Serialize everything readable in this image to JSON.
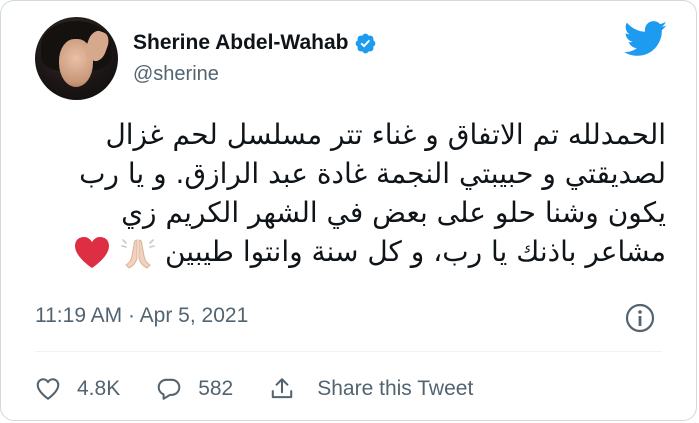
{
  "author": {
    "display_name": "Sherine Abdel-Wahab",
    "handle": "@sherine",
    "verified": true
  },
  "tweet": {
    "text_lines": [
      "الحمدلله تم الاتفاق و غناء تتر مسلسل لحم غزال",
      "لصديقتي و حبيبتي النجمة غادة عبد الرازق. و يا رب",
      "يكون وشنا حلو على بعض في الشهر الكريم زي",
      "مشاعر باذنك يا رب، و كل سنة وانتوا طيبين"
    ],
    "emojis": [
      "folded-hands-emoji",
      "red-heart-emoji"
    ],
    "timestamp": "11:19 AM · Apr 5, 2021"
  },
  "actions": {
    "like_count": "4.8K",
    "reply_count": "582",
    "share_label": "Share this Tweet"
  },
  "colors": {
    "brand_blue": "#1d9bf0",
    "text_primary": "#0f1419",
    "text_secondary": "#536471",
    "heart_red": "#dd2e44"
  }
}
